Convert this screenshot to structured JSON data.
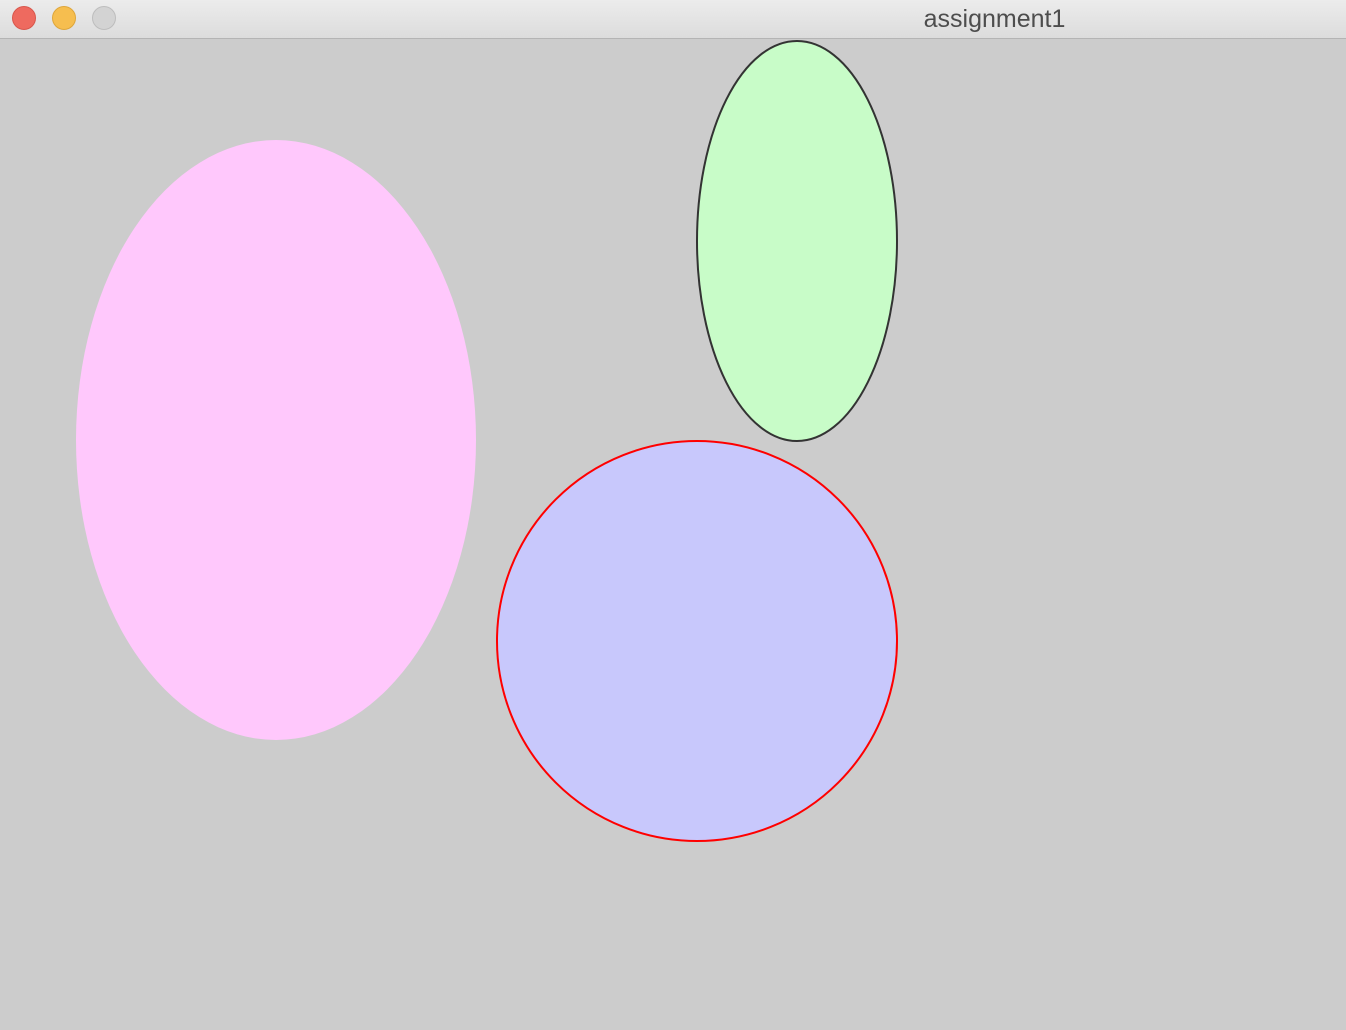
{
  "window": {
    "title": "assignment1",
    "controls": {
      "close": {
        "icon": "close-dot-icon",
        "color": "#ee6a5f"
      },
      "minimize": {
        "icon": "minimize-dot-icon",
        "color": "#f6be4f"
      },
      "zoom": {
        "icon": "zoom-dot-icon",
        "color": "#d3d3d3"
      }
    }
  },
  "canvas": {
    "background": "#cccccc",
    "shapes": [
      {
        "name": "pink-ellipse",
        "fill": "#ffc8fc",
        "stroke": "none"
      },
      {
        "name": "green-ellipse",
        "fill": "#c8fcc8",
        "stroke": "#333333"
      },
      {
        "name": "blue-circle",
        "fill": "#c8c8fc",
        "stroke": "#ff0000"
      }
    ]
  }
}
